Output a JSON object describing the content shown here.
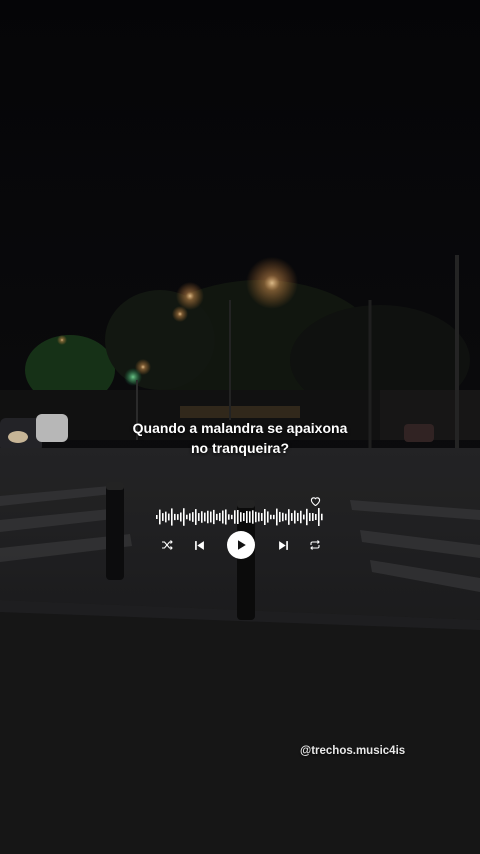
{
  "story": {
    "caption_line1": "Quando a malandra se apaixona",
    "caption_line2": "no tranqueira?",
    "handle": "@trechos.music4is"
  },
  "player": {
    "icons": [
      "heart-icon",
      "shuffle-icon",
      "previous-icon",
      "play-icon",
      "next-icon",
      "repeat-icon"
    ]
  },
  "colors": {
    "text": "#ffffff",
    "background": "#0b0b0d"
  }
}
